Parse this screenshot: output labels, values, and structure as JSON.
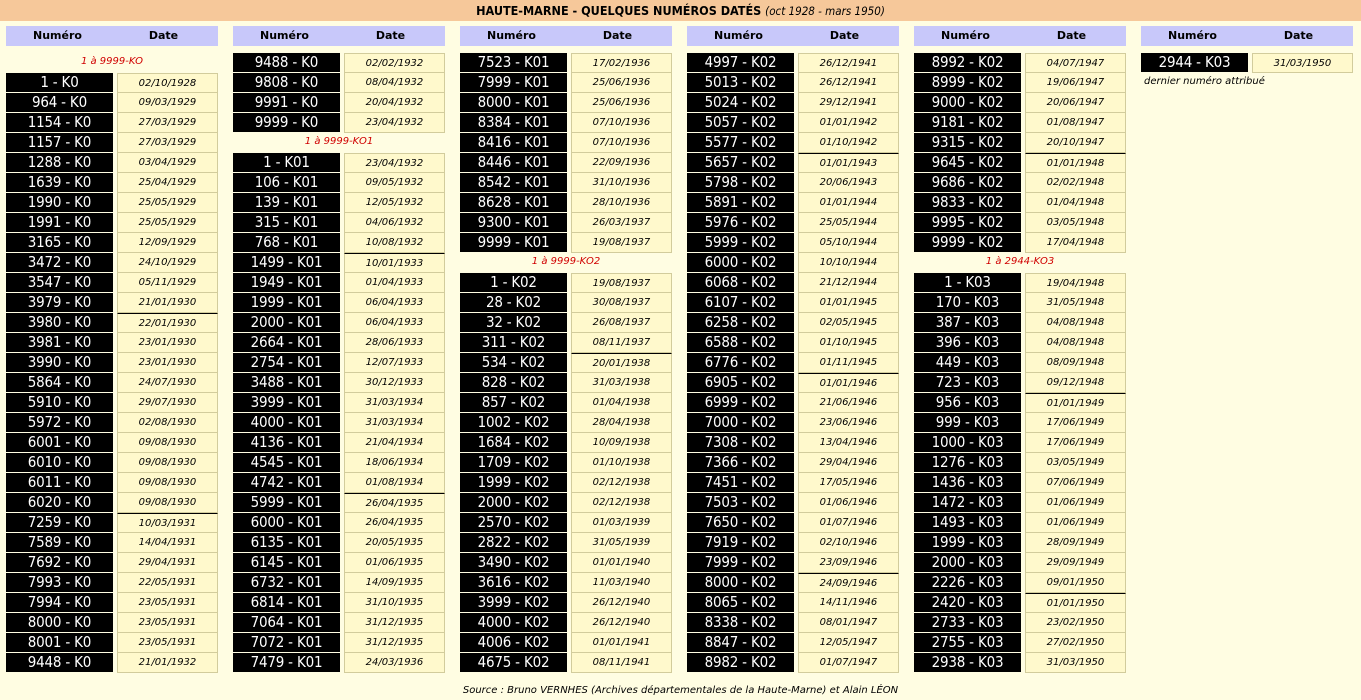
{
  "title": {
    "main": "HAUTE-MARNE - QUELQUES NUMÉROS DATÉS",
    "sub": "(oct 1928 - mars 1950)"
  },
  "headers": {
    "numero": "Numéro",
    "date": "Date"
  },
  "columns": [
    {
      "sections": [
        {
          "label": "1 à 9999-KO",
          "rows": [
            [
              "1 - K0",
              "02/10/1928"
            ],
            [
              "964 - K0",
              "09/03/1929"
            ],
            [
              "1154 - K0",
              "27/03/1929"
            ],
            [
              "1157 - K0",
              "27/03/1929"
            ],
            [
              "1288 - K0",
              "03/04/1929"
            ],
            [
              "1639 - K0",
              "25/04/1929"
            ],
            [
              "1990 - K0",
              "25/05/1929"
            ],
            [
              "1991 - K0",
              "25/05/1929"
            ],
            [
              "3165 - K0",
              "12/09/1929"
            ],
            [
              "3472 - K0",
              "24/10/1929"
            ],
            [
              "3547 - K0",
              "05/11/1929"
            ],
            [
              "3979 - K0",
              "21/01/1930"
            ],
            [
              "3980 - K0",
              "22/01/1930"
            ],
            [
              "3981 - K0",
              "23/01/1930"
            ],
            [
              "3990 - K0",
              "23/01/1930"
            ],
            [
              "5864 - K0",
              "24/07/1930"
            ],
            [
              "5910 - K0",
              "29/07/1930"
            ],
            [
              "5972 - K0",
              "02/08/1930"
            ],
            [
              "6001 - K0",
              "09/08/1930"
            ],
            [
              "6010 - K0",
              "09/08/1930"
            ],
            [
              "6011 - K0",
              "09/08/1930"
            ],
            [
              "6020 - K0",
              "09/08/1930"
            ],
            [
              "7259 - K0",
              "10/03/1931"
            ],
            [
              "7589 - K0",
              "14/04/1931"
            ],
            [
              "7692 - K0",
              "29/04/1931"
            ],
            [
              "7993 - K0",
              "22/05/1931"
            ],
            [
              "7994 - K0",
              "23/05/1931"
            ],
            [
              "8000 - K0",
              "23/05/1931"
            ],
            [
              "8001 - K0",
              "23/05/1931"
            ],
            [
              "9448 - K0",
              "21/01/1932"
            ]
          ]
        }
      ]
    },
    {
      "sections": [
        {
          "label": "",
          "rows": [
            [
              "9488 - K0",
              "02/02/1932"
            ],
            [
              "9808 - K0",
              "08/04/1932"
            ],
            [
              "9991 - K0",
              "20/04/1932"
            ],
            [
              "9999 - K0",
              "23/04/1932"
            ]
          ]
        },
        {
          "label": "1 à 9999-KO1",
          "rows": [
            [
              "1 - K01",
              "23/04/1932"
            ],
            [
              "106 - K01",
              "09/05/1932"
            ],
            [
              "139 - K01",
              "12/05/1932"
            ],
            [
              "315 - K01",
              "04/06/1932"
            ],
            [
              "768 - K01",
              "10/08/1932"
            ],
            [
              "1499 - K01",
              "10/01/1933"
            ],
            [
              "1949 - K01",
              "01/04/1933"
            ],
            [
              "1999 - K01",
              "06/04/1933"
            ],
            [
              "2000 - K01",
              "06/04/1933"
            ],
            [
              "2664 - K01",
              "28/06/1933"
            ],
            [
              "2754 - K01",
              "12/07/1933"
            ],
            [
              "3488 - K01",
              "30/12/1933"
            ],
            [
              "3999 - K01",
              "31/03/1934"
            ],
            [
              "4000 - K01",
              "31/03/1934"
            ],
            [
              "4136 - K01",
              "21/04/1934"
            ],
            [
              "4545 - K01",
              "18/06/1934"
            ],
            [
              "4742 - K01",
              "01/08/1934"
            ],
            [
              "5999 - K01",
              "26/04/1935"
            ],
            [
              "6000 - K01",
              "26/04/1935"
            ],
            [
              "6135 - K01",
              "20/05/1935"
            ],
            [
              "6145 - K01",
              "01/06/1935"
            ],
            [
              "6732 - K01",
              "14/09/1935"
            ],
            [
              "6814 - K01",
              "31/10/1935"
            ],
            [
              "7064 - K01",
              "31/12/1935"
            ],
            [
              "7072 - K01",
              "31/12/1935"
            ],
            [
              "7479 - K01",
              "24/03/1936"
            ]
          ]
        }
      ]
    },
    {
      "sections": [
        {
          "label": "",
          "rows": [
            [
              "7523 - K01",
              "17/02/1936"
            ],
            [
              "7999 - K01",
              "25/06/1936"
            ],
            [
              "8000 - K01",
              "25/06/1936"
            ],
            [
              "8384 - K01",
              "07/10/1936"
            ],
            [
              "8416 - K01",
              "07/10/1936"
            ],
            [
              "8446 - K01",
              "22/09/1936"
            ],
            [
              "8542 - K01",
              "31/10/1936"
            ],
            [
              "8628 - K01",
              "28/10/1936"
            ],
            [
              "9300 - K01",
              "26/03/1937"
            ],
            [
              "9999 - K01",
              "19/08/1937"
            ]
          ]
        },
        {
          "label": "1 à 9999-KO2",
          "rows": [
            [
              "1 - K02",
              "19/08/1937"
            ],
            [
              "28 - K02",
              "30/08/1937"
            ],
            [
              "32 - K02",
              "26/08/1937"
            ],
            [
              "311 - K02",
              "08/11/1937"
            ],
            [
              "534 - K02",
              "20/01/1938"
            ],
            [
              "828 - K02",
              "31/03/1938"
            ],
            [
              "857 - K02",
              "01/04/1938"
            ],
            [
              "1002 - K02",
              "28/04/1938"
            ],
            [
              "1684 - K02",
              "10/09/1938"
            ],
            [
              "1709 - K02",
              "01/10/1938"
            ],
            [
              "1999 - K02",
              "02/12/1938"
            ],
            [
              "2000 - K02",
              "02/12/1938"
            ],
            [
              "2570 - K02",
              "01/03/1939"
            ],
            [
              "2822 - K02",
              "31/05/1939"
            ],
            [
              "3490 - K02",
              "01/01/1940"
            ],
            [
              "3616 - K02",
              "11/03/1940"
            ],
            [
              "3999 - K02",
              "26/12/1940"
            ],
            [
              "4000 - K02",
              "26/12/1940"
            ],
            [
              "4006 - K02",
              "01/01/1941"
            ],
            [
              "4675 - K02",
              "08/11/1941"
            ]
          ]
        }
      ]
    },
    {
      "sections": [
        {
          "label": "",
          "rows": [
            [
              "4997 - K02",
              "26/12/1941"
            ],
            [
              "5013 - K02",
              "26/12/1941"
            ],
            [
              "5024 - K02",
              "29/12/1941"
            ],
            [
              "5057 - K02",
              "01/01/1942"
            ],
            [
              "5577 - K02",
              "01/10/1942"
            ],
            [
              "5657 - K02",
              "01/01/1943"
            ],
            [
              "5798 - K02",
              "20/06/1943"
            ],
            [
              "5891 - K02",
              "01/01/1944"
            ],
            [
              "5976 - K02",
              "25/05/1944"
            ],
            [
              "5999 - K02",
              "05/10/1944"
            ],
            [
              "6000 - K02",
              "10/10/1944"
            ],
            [
              "6068 - K02",
              "21/12/1944"
            ],
            [
              "6107 - K02",
              "01/01/1945"
            ],
            [
              "6258 - K02",
              "02/05/1945"
            ],
            [
              "6588 - K02",
              "01/10/1945"
            ],
            [
              "6776 - K02",
              "01/11/1945"
            ],
            [
              "6905 - K02",
              "01/01/1946"
            ],
            [
              "6999 - K02",
              "21/06/1946"
            ],
            [
              "7000 - K02",
              "23/06/1946"
            ],
            [
              "7308 - K02",
              "13/04/1946"
            ],
            [
              "7366 - K02",
              "29/04/1946"
            ],
            [
              "7451 - K02",
              "17/05/1946"
            ],
            [
              "7503 - K02",
              "01/06/1946"
            ],
            [
              "7650 - K02",
              "01/07/1946"
            ],
            [
              "7919 - K02",
              "02/10/1946"
            ],
            [
              "7999 - K02",
              "23/09/1946"
            ],
            [
              "8000 - K02",
              "24/09/1946"
            ],
            [
              "8065 - K02",
              "14/11/1946"
            ],
            [
              "8338 - K02",
              "08/01/1947"
            ],
            [
              "8847 - K02",
              "12/05/1947"
            ],
            [
              "8982 - K02",
              "01/07/1947"
            ]
          ]
        }
      ]
    },
    {
      "sections": [
        {
          "label": "",
          "rows": [
            [
              "8992 - K02",
              "04/07/1947"
            ],
            [
              "8999 - K02",
              "19/06/1947"
            ],
            [
              "9000 - K02",
              "20/06/1947"
            ],
            [
              "9181 - K02",
              "01/08/1947"
            ],
            [
              "9315 - K02",
              "20/10/1947"
            ],
            [
              "9645 - K02",
              "01/01/1948"
            ],
            [
              "9686 - K02",
              "02/02/1948"
            ],
            [
              "9833 - K02",
              "01/04/1948"
            ],
            [
              "9995 - K02",
              "03/05/1948"
            ],
            [
              "9999 - K02",
              "17/04/1948"
            ]
          ]
        },
        {
          "label": "1 à 2944-KO3",
          "rows": [
            [
              "1 - K03",
              "19/04/1948"
            ],
            [
              "170 - K03",
              "31/05/1948"
            ],
            [
              "387 - K03",
              "04/08/1948"
            ],
            [
              "396 - K03",
              "04/08/1948"
            ],
            [
              "449 - K03",
              "08/09/1948"
            ],
            [
              "723 - K03",
              "09/12/1948"
            ],
            [
              "956 - K03",
              "01/01/1949"
            ],
            [
              "999 - K03",
              "17/06/1949"
            ],
            [
              "1000 - K03",
              "17/06/1949"
            ],
            [
              "1276 - K03",
              "03/05/1949"
            ],
            [
              "1436 - K03",
              "07/06/1949"
            ],
            [
              "1472 - K03",
              "01/06/1949"
            ],
            [
              "1493 - K03",
              "01/06/1949"
            ],
            [
              "1999 - K03",
              "28/09/1949"
            ],
            [
              "2000 - K03",
              "29/09/1949"
            ],
            [
              "2226 - K03",
              "09/01/1950"
            ],
            [
              "2420 - K03",
              "01/01/1950"
            ],
            [
              "2733 - K03",
              "23/02/1950"
            ],
            [
              "2755 - K03",
              "27/02/1950"
            ],
            [
              "2938 - K03",
              "31/03/1950"
            ]
          ]
        }
      ]
    },
    {
      "sections": [
        {
          "label": "",
          "rows": [
            [
              "2944 - K03",
              "31/03/1950"
            ]
          ]
        }
      ],
      "note": "dernier numéro attribué"
    }
  ],
  "footer": "Source : Bruno VERNHES (Archives départementales de la Haute-Marne) et Alain LÉON"
}
